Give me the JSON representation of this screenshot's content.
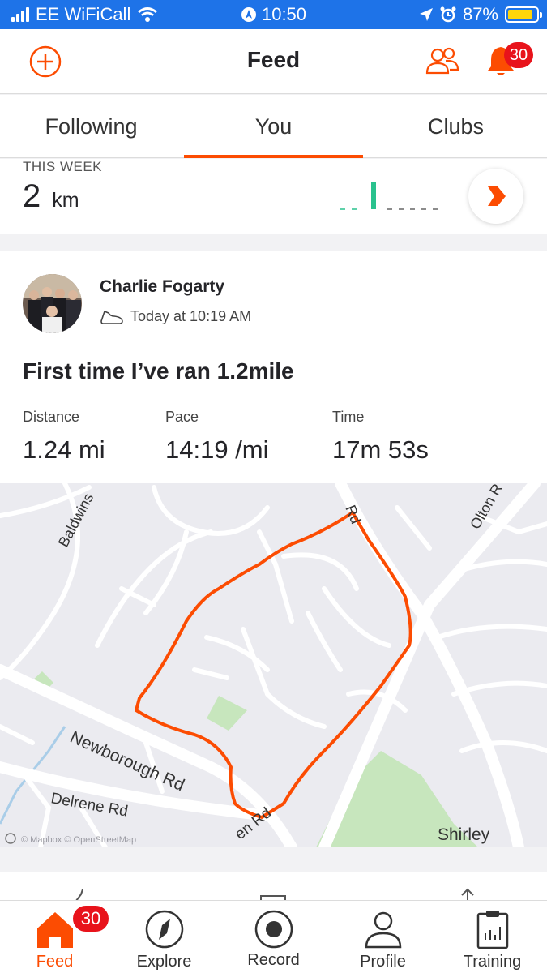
{
  "status_bar": {
    "carrier": "EE WiFiCall",
    "time": "10:50",
    "battery": "87%",
    "battery_level": 0.87
  },
  "header": {
    "title": "Feed",
    "notification_count": "30"
  },
  "tabs": [
    {
      "label": "Following",
      "active": false
    },
    {
      "label": "You",
      "active": true
    },
    {
      "label": "Clubs",
      "active": false
    }
  ],
  "this_week": {
    "label": "THIS WEEK",
    "distance": "2",
    "unit": "km"
  },
  "activity": {
    "athlete": "Charlie Fogarty",
    "time": "Today at 10:19 AM",
    "title": "First time I’ve ran 1.2mile",
    "stats": [
      {
        "label": "Distance",
        "value": "1.24 mi"
      },
      {
        "label": "Pace",
        "value": "14:19 /mi"
      },
      {
        "label": "Time",
        "value": "17m 53s"
      }
    ],
    "map": {
      "labels": {
        "baldwins": "Baldwins",
        "rd_top": "Rd",
        "olton": "Olton R",
        "newborough": "Newborough Rd",
        "delrene": "Delrene Rd",
        "en_rd": "en Rd",
        "shirley": "Shirley",
        "attribution": "© Mapbox © OpenStreetMap"
      }
    }
  },
  "bottom_nav": {
    "items": [
      {
        "label": "Feed",
        "active": true
      },
      {
        "label": "Explore",
        "active": false
      },
      {
        "label": "Record",
        "active": false
      },
      {
        "label": "Profile",
        "active": false
      },
      {
        "label": "Training",
        "active": false
      }
    ],
    "feed_badge": "30"
  },
  "colors": {
    "accent": "#fc4c02",
    "status_bar": "#1e73e8",
    "badge": "#e8131b",
    "chart_bar": "#2ac28e"
  }
}
